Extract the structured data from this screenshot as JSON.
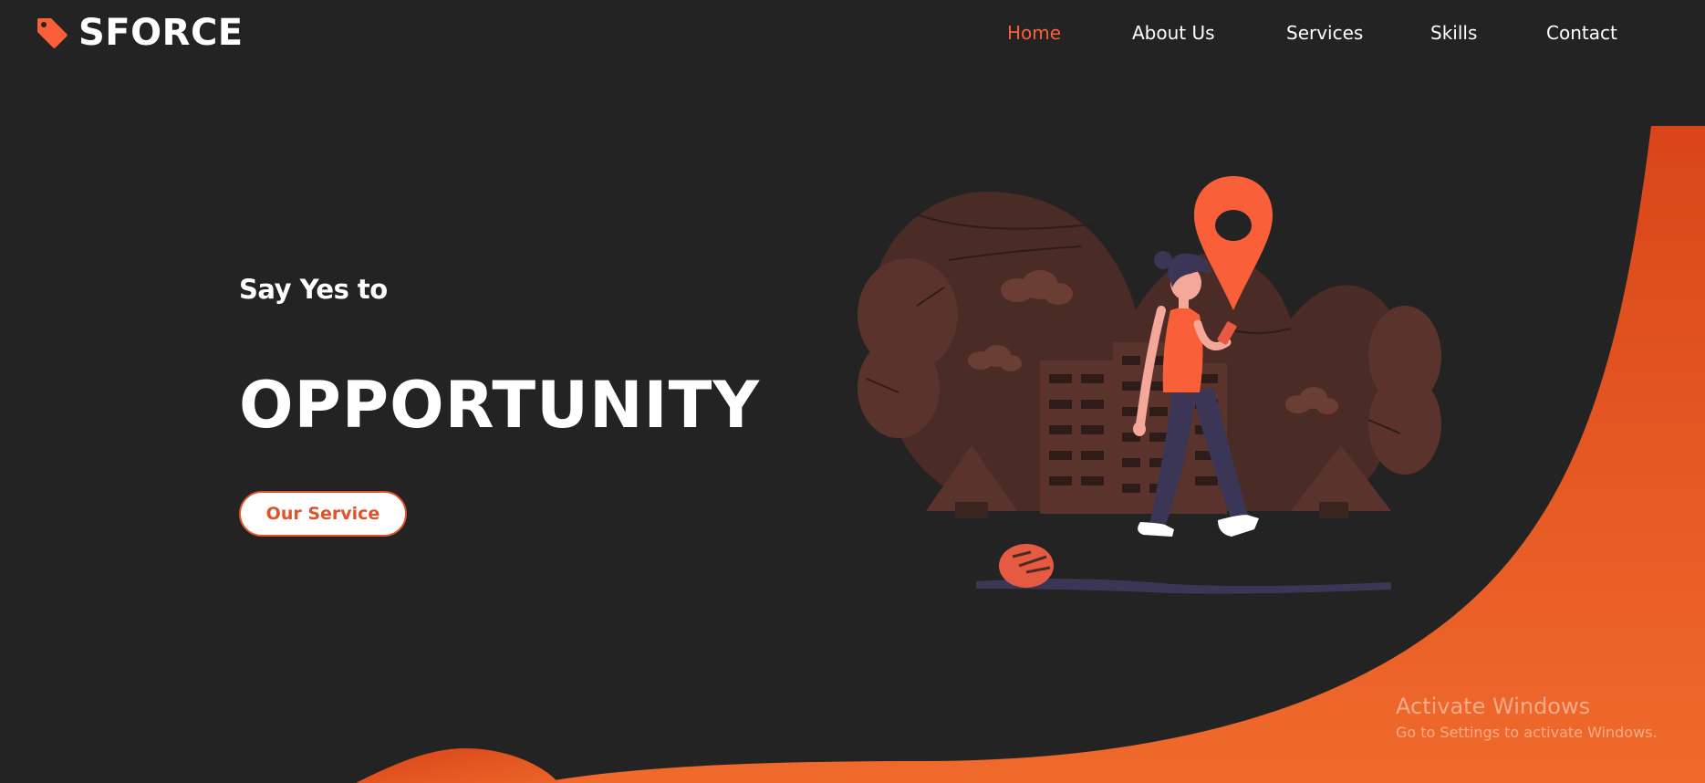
{
  "brand": {
    "name": "SFORCE",
    "icon": "tag-icon",
    "accent_color": "#f9603a"
  },
  "nav": {
    "items": [
      {
        "label": "Home",
        "active": true
      },
      {
        "label": "About Us",
        "active": false
      },
      {
        "label": "Services",
        "active": false
      },
      {
        "label": "Skills",
        "active": false
      },
      {
        "label": "Contact",
        "active": false
      }
    ]
  },
  "hero": {
    "tagline": "Say Yes to",
    "headline": "OPPORTUNITY",
    "cta_label": "Our Service"
  },
  "illustration": {
    "icons": [
      "map-pin-icon",
      "woman-walking-icon",
      "phone-icon",
      "building-icon",
      "tree-icon",
      "cloud-icon",
      "bush-icon"
    ]
  },
  "colors": {
    "background": "#232323",
    "orange_dark": "#d9451a",
    "orange_light": "#f06a2c",
    "text": "#ffffff"
  },
  "system_watermark": {
    "title": "Activate Windows",
    "subtitle": "Go to Settings to activate Windows."
  }
}
